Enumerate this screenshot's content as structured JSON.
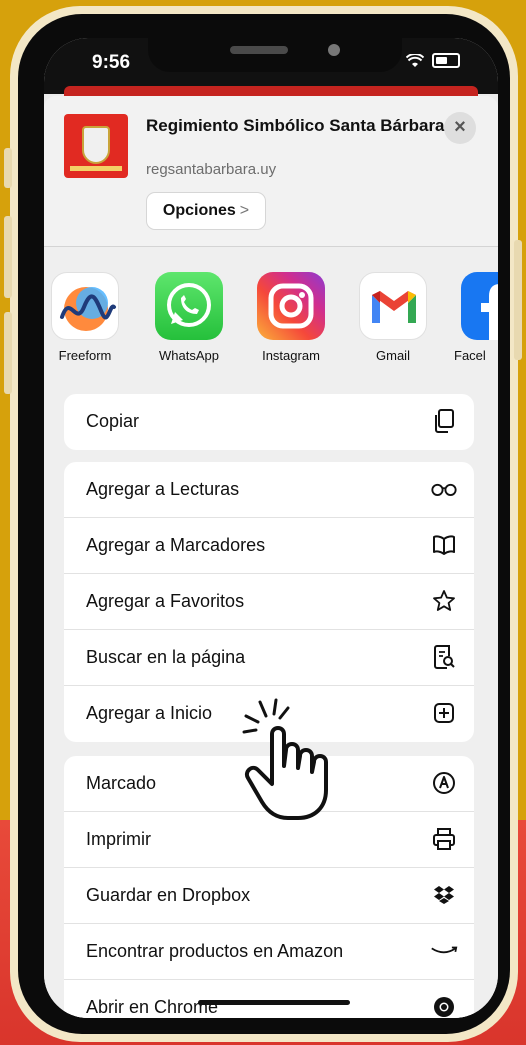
{
  "status": {
    "time": "9:56"
  },
  "header": {
    "title": "Regimiento Simbólico Santa Bárbara",
    "url": "regsantabarbara.uy",
    "options_label": "Opciones",
    "options_chevron": ">",
    "close_label": "×"
  },
  "apps": [
    {
      "label": "Freeform",
      "icon": "freeform-icon"
    },
    {
      "label": "WhatsApp",
      "icon": "whatsapp-icon"
    },
    {
      "label": "Instagram",
      "icon": "instagram-icon"
    },
    {
      "label": "Gmail",
      "icon": "gmail-icon"
    },
    {
      "label": "Facel",
      "icon": "facebook-icon"
    }
  ],
  "actions": {
    "group1": [
      {
        "label": "Copiar",
        "icon": "copy-icon"
      }
    ],
    "group2": [
      {
        "label": "Agregar a Lecturas",
        "icon": "glasses-icon"
      },
      {
        "label": "Agregar a Marcadores",
        "icon": "book-icon"
      },
      {
        "label": "Agregar a Favoritos",
        "icon": "star-icon"
      },
      {
        "label": "Buscar en la página",
        "icon": "find-page-icon"
      },
      {
        "label": "Agregar a Inicio",
        "icon": "add-square-icon"
      }
    ],
    "group3": [
      {
        "label": "Marcado",
        "icon": "markup-icon"
      },
      {
        "label": "Imprimir",
        "icon": "printer-icon"
      },
      {
        "label": "Guardar en Dropbox",
        "icon": "dropbox-icon"
      },
      {
        "label": "Encontrar productos en Amazon",
        "icon": "amazon-icon"
      },
      {
        "label": "Abrir en Chrome",
        "icon": "chrome-icon"
      }
    ]
  },
  "colors": {
    "background_yellow": "#d6a10c",
    "background_red": "#e84a3a",
    "accent_red": "#c5241f"
  }
}
